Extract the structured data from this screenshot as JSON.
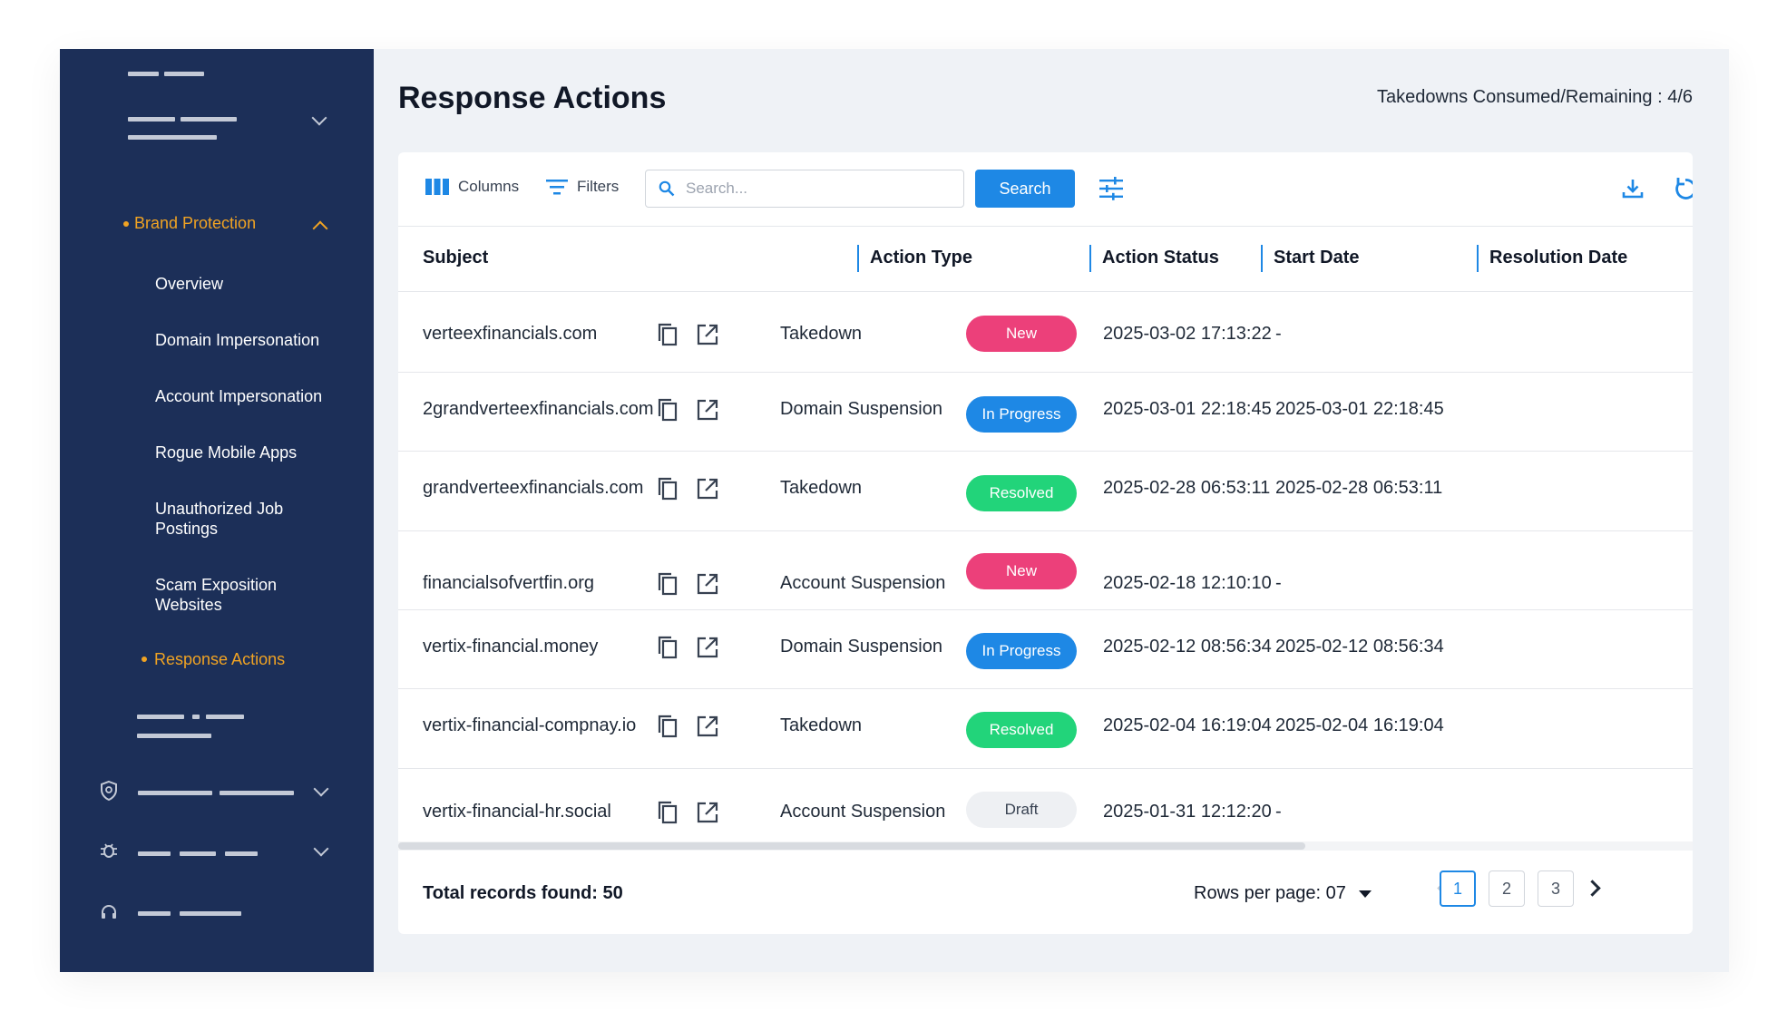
{
  "sidebar": {
    "group_label": "Brand Protection",
    "items": [
      {
        "label": "Overview"
      },
      {
        "label": "Domain Impersonation"
      },
      {
        "label": "Account Impersonation"
      },
      {
        "label": "Rogue Mobile Apps"
      },
      {
        "label": "Unauthorized Job Postings"
      },
      {
        "label": "Scam Exposition Websites"
      },
      {
        "label": "Response Actions",
        "active": true
      }
    ]
  },
  "header": {
    "title": "Response Actions",
    "quota": "Takedowns Consumed/Remaining : 4/6"
  },
  "toolbar": {
    "columns_label": "Columns",
    "filters_label": "Filters",
    "search_placeholder": "Search...",
    "search_button": "Search"
  },
  "table": {
    "columns": [
      "Subject",
      "Action Type",
      "Action Status",
      "Start Date",
      "Resolution Date"
    ],
    "rows": [
      {
        "subject": "verteexfinancials.com",
        "action_type": "Takedown",
        "status": "New",
        "start": "2025-03-02 17:13:22",
        "resolution": "-"
      },
      {
        "subject": "2grandverteexfinancials.com",
        "action_type": "Domain Suspension",
        "status": "In Progress",
        "start": "2025-03-01 22:18:45",
        "resolution": "2025-03-01 22:18:45"
      },
      {
        "subject": "grandverteexfinancials.com",
        "action_type": "Takedown",
        "status": "Resolved",
        "start": "2025-02-28 06:53:11",
        "resolution": "2025-02-28 06:53:11"
      },
      {
        "subject": "financialsofvertfin.org",
        "action_type": "Account Suspension",
        "status": "New",
        "start": "2025-02-18 12:10:10",
        "resolution": "-"
      },
      {
        "subject": "vertix-financial.money",
        "action_type": "Domain Suspension",
        "status": "In Progress",
        "start": "2025-02-12 08:56:34",
        "resolution": "2025-02-12 08:56:34"
      },
      {
        "subject": "vertix-financial-compnay.io",
        "action_type": "Takedown",
        "status": "Resolved",
        "start": "2025-02-04 16:19:04",
        "resolution": "2025-02-04 16:19:04"
      },
      {
        "subject": "vertix-financial-hr.social",
        "action_type": "Account Suspension",
        "status": "Draft",
        "start": "2025-01-31 12:12:20",
        "resolution": "-"
      }
    ]
  },
  "status_colors": {
    "New": "#ec407a",
    "In Progress": "#1e88e5",
    "Resolved": "#22d47a",
    "Draft": "#eef0f3"
  },
  "footer": {
    "total": "Total records found: 50",
    "rows_per_page": "Rows per page: 07",
    "pages": [
      "1",
      "2",
      "3"
    ],
    "current_page": "1"
  },
  "icons": {
    "row_actions": [
      "copy-icon",
      "external-link-icon"
    ],
    "toolbar": [
      "columns-icon",
      "filters-icon",
      "search-icon",
      "adjust-icon",
      "download-icon",
      "refresh-icon"
    ]
  }
}
